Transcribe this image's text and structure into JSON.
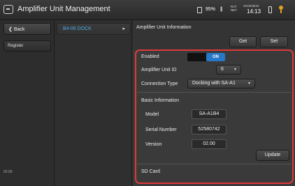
{
  "app": {
    "title": "Amplifier Unit Management",
    "icon": "window-icon"
  },
  "status_bar": {
    "battery_percent": "95%",
    "signal_glyph": "|||",
    "network": [
      "RAT",
      "NET"
    ],
    "date": "2015/08/20",
    "time": "14:13"
  },
  "left": {
    "back_label": "Back",
    "register_label": "Register",
    "bottom_text": "02:00"
  },
  "middle": {
    "dock_label": "B4-06  DOCK",
    "dock_arrow": "▸"
  },
  "right": {
    "title": "Amplifier Unit Information",
    "get_label": "Get",
    "set_label": "Set",
    "enabled_label": "Enabled",
    "enabled_value": "ON",
    "unit_id_label": "Amplifier Unit ID",
    "unit_id_value": "6",
    "connection_label": "Connection Type",
    "connection_value": "Docking with SA-A1",
    "basic_info_heading": "Basic Information",
    "model_label": "Model",
    "model_value": "SA-A1B4",
    "serial_label": "Serial Number",
    "serial_value": "52580742",
    "version_label": "Version",
    "version_value": "02.00",
    "update_label": "Update",
    "sd_card_heading": "SD Card"
  },
  "colors": {
    "accent": "#2878c8",
    "highlight": "#e03a3a",
    "dock_text": "#4ea8e8"
  }
}
